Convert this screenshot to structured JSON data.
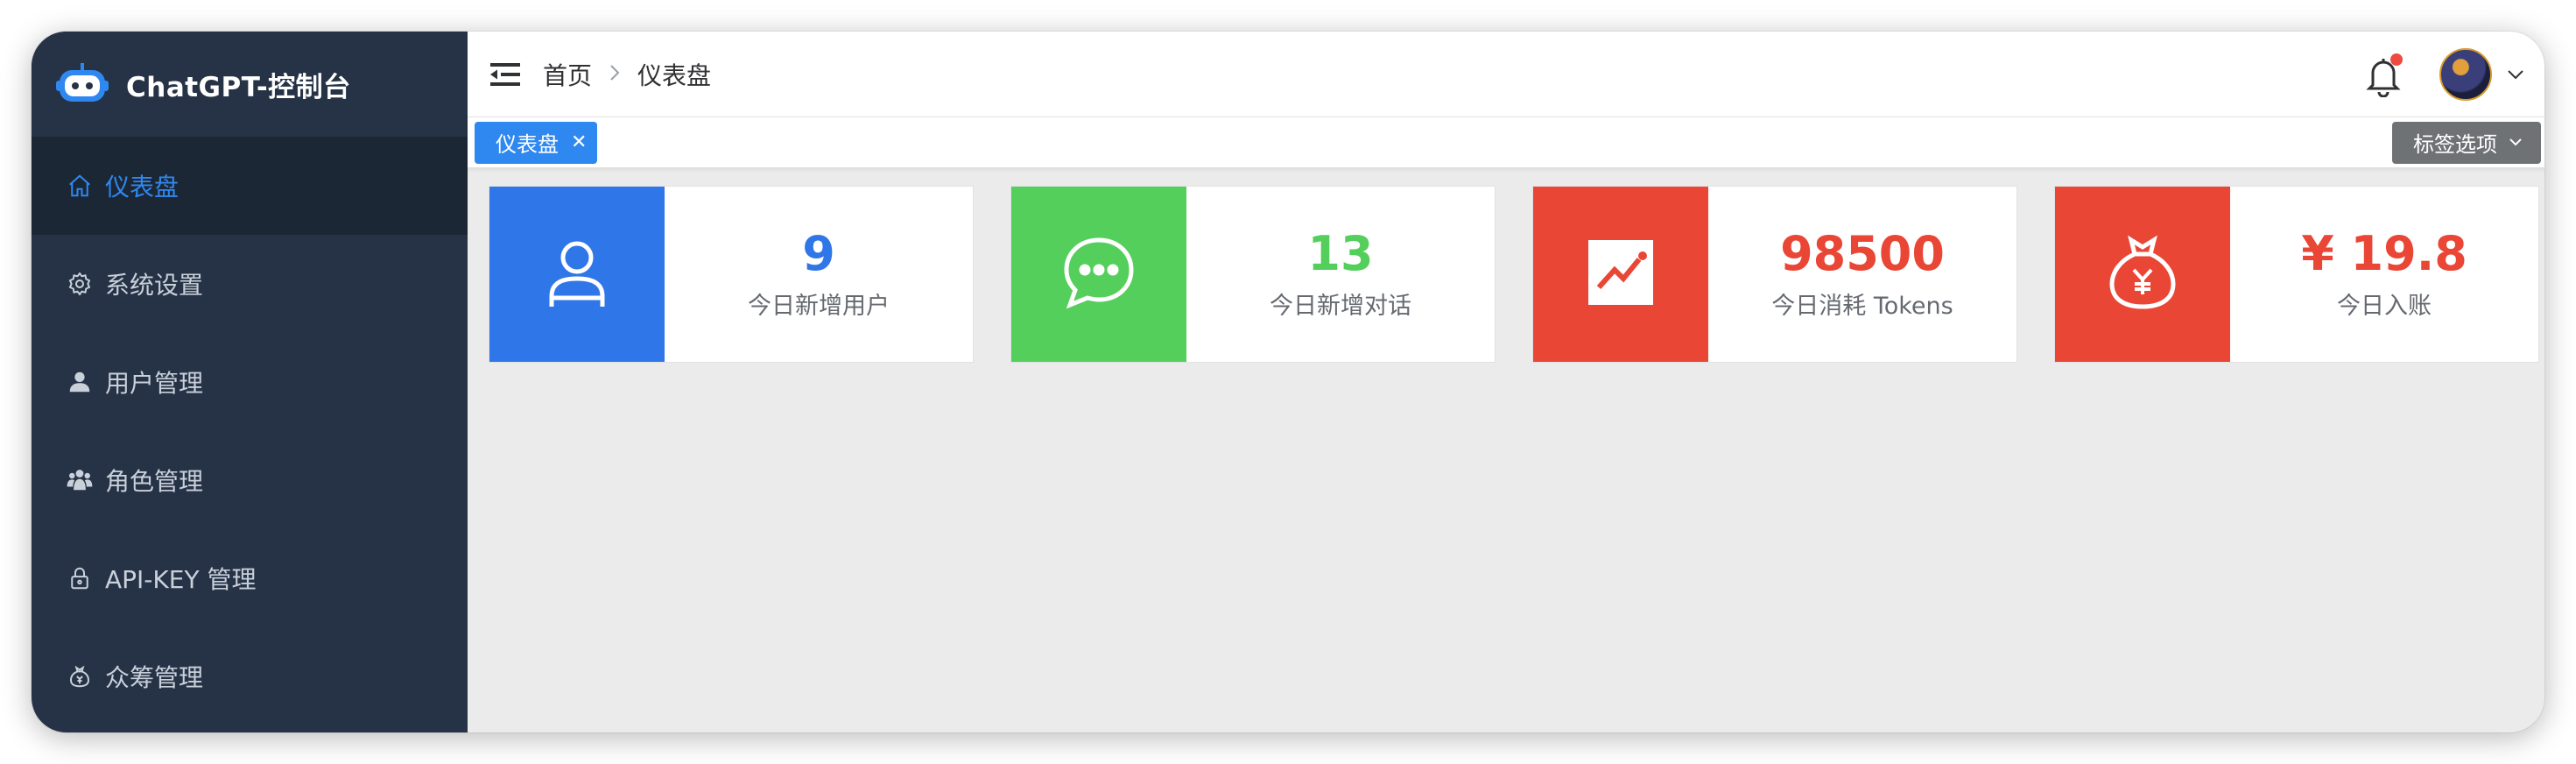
{
  "app": {
    "title": "ChatGPT-控制台"
  },
  "sidebar": {
    "items": [
      {
        "label": "仪表盘",
        "icon": "home-icon",
        "active": true
      },
      {
        "label": "系统设置",
        "icon": "gear-icon",
        "active": false
      },
      {
        "label": "用户管理",
        "icon": "user-icon",
        "active": false
      },
      {
        "label": "角色管理",
        "icon": "team-icon",
        "active": false
      },
      {
        "label": "API-KEY 管理",
        "icon": "lock-icon",
        "active": false
      },
      {
        "label": "众筹管理",
        "icon": "money-bag-icon",
        "active": false
      }
    ]
  },
  "header": {
    "breadcrumb": [
      "首页",
      "仪表盘"
    ],
    "notification_dot": true
  },
  "tabs": {
    "items": [
      {
        "label": "仪表盘",
        "closable": true
      }
    ],
    "options_label": "标签选项"
  },
  "stats": [
    {
      "value": "9",
      "label": "今日新增用户",
      "color": "#2f77e9",
      "icon": "user-outline-icon"
    },
    {
      "value": "13",
      "label": "今日新增对话",
      "color": "#55cf5b",
      "icon": "chat-bubble-icon"
    },
    {
      "value": "98500",
      "label": "今日消耗 Tokens",
      "color": "#ea4635",
      "icon": "trend-chart-icon"
    },
    {
      "value": "¥ 19.8",
      "label": "今日入账",
      "color": "#ea4635",
      "icon": "money-bag-icon"
    }
  ],
  "colors": {
    "sidebar_bg": "#263346",
    "accent": "#2f88f0",
    "content_bg": "#ebebeb"
  }
}
